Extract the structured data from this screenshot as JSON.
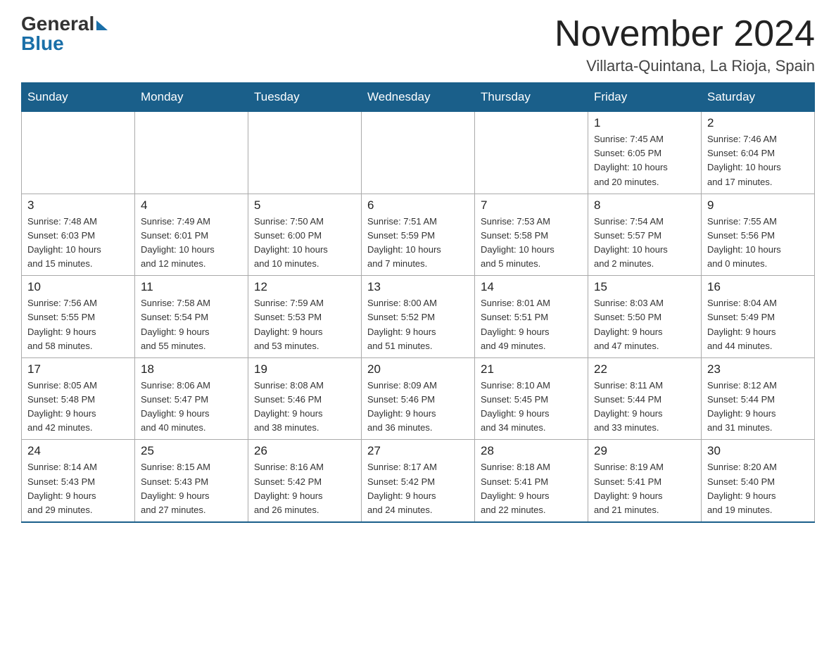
{
  "header": {
    "logo_general": "General",
    "logo_blue": "Blue",
    "month_year": "November 2024",
    "location": "Villarta-Quintana, La Rioja, Spain"
  },
  "days_of_week": [
    "Sunday",
    "Monday",
    "Tuesday",
    "Wednesday",
    "Thursday",
    "Friday",
    "Saturday"
  ],
  "weeks": [
    {
      "days": [
        {
          "number": "",
          "info": ""
        },
        {
          "number": "",
          "info": ""
        },
        {
          "number": "",
          "info": ""
        },
        {
          "number": "",
          "info": ""
        },
        {
          "number": "",
          "info": ""
        },
        {
          "number": "1",
          "info": "Sunrise: 7:45 AM\nSunset: 6:05 PM\nDaylight: 10 hours\nand 20 minutes."
        },
        {
          "number": "2",
          "info": "Sunrise: 7:46 AM\nSunset: 6:04 PM\nDaylight: 10 hours\nand 17 minutes."
        }
      ]
    },
    {
      "days": [
        {
          "number": "3",
          "info": "Sunrise: 7:48 AM\nSunset: 6:03 PM\nDaylight: 10 hours\nand 15 minutes."
        },
        {
          "number": "4",
          "info": "Sunrise: 7:49 AM\nSunset: 6:01 PM\nDaylight: 10 hours\nand 12 minutes."
        },
        {
          "number": "5",
          "info": "Sunrise: 7:50 AM\nSunset: 6:00 PM\nDaylight: 10 hours\nand 10 minutes."
        },
        {
          "number": "6",
          "info": "Sunrise: 7:51 AM\nSunset: 5:59 PM\nDaylight: 10 hours\nand 7 minutes."
        },
        {
          "number": "7",
          "info": "Sunrise: 7:53 AM\nSunset: 5:58 PM\nDaylight: 10 hours\nand 5 minutes."
        },
        {
          "number": "8",
          "info": "Sunrise: 7:54 AM\nSunset: 5:57 PM\nDaylight: 10 hours\nand 2 minutes."
        },
        {
          "number": "9",
          "info": "Sunrise: 7:55 AM\nSunset: 5:56 PM\nDaylight: 10 hours\nand 0 minutes."
        }
      ]
    },
    {
      "days": [
        {
          "number": "10",
          "info": "Sunrise: 7:56 AM\nSunset: 5:55 PM\nDaylight: 9 hours\nand 58 minutes."
        },
        {
          "number": "11",
          "info": "Sunrise: 7:58 AM\nSunset: 5:54 PM\nDaylight: 9 hours\nand 55 minutes."
        },
        {
          "number": "12",
          "info": "Sunrise: 7:59 AM\nSunset: 5:53 PM\nDaylight: 9 hours\nand 53 minutes."
        },
        {
          "number": "13",
          "info": "Sunrise: 8:00 AM\nSunset: 5:52 PM\nDaylight: 9 hours\nand 51 minutes."
        },
        {
          "number": "14",
          "info": "Sunrise: 8:01 AM\nSunset: 5:51 PM\nDaylight: 9 hours\nand 49 minutes."
        },
        {
          "number": "15",
          "info": "Sunrise: 8:03 AM\nSunset: 5:50 PM\nDaylight: 9 hours\nand 47 minutes."
        },
        {
          "number": "16",
          "info": "Sunrise: 8:04 AM\nSunset: 5:49 PM\nDaylight: 9 hours\nand 44 minutes."
        }
      ]
    },
    {
      "days": [
        {
          "number": "17",
          "info": "Sunrise: 8:05 AM\nSunset: 5:48 PM\nDaylight: 9 hours\nand 42 minutes."
        },
        {
          "number": "18",
          "info": "Sunrise: 8:06 AM\nSunset: 5:47 PM\nDaylight: 9 hours\nand 40 minutes."
        },
        {
          "number": "19",
          "info": "Sunrise: 8:08 AM\nSunset: 5:46 PM\nDaylight: 9 hours\nand 38 minutes."
        },
        {
          "number": "20",
          "info": "Sunrise: 8:09 AM\nSunset: 5:46 PM\nDaylight: 9 hours\nand 36 minutes."
        },
        {
          "number": "21",
          "info": "Sunrise: 8:10 AM\nSunset: 5:45 PM\nDaylight: 9 hours\nand 34 minutes."
        },
        {
          "number": "22",
          "info": "Sunrise: 8:11 AM\nSunset: 5:44 PM\nDaylight: 9 hours\nand 33 minutes."
        },
        {
          "number": "23",
          "info": "Sunrise: 8:12 AM\nSunset: 5:44 PM\nDaylight: 9 hours\nand 31 minutes."
        }
      ]
    },
    {
      "days": [
        {
          "number": "24",
          "info": "Sunrise: 8:14 AM\nSunset: 5:43 PM\nDaylight: 9 hours\nand 29 minutes."
        },
        {
          "number": "25",
          "info": "Sunrise: 8:15 AM\nSunset: 5:43 PM\nDaylight: 9 hours\nand 27 minutes."
        },
        {
          "number": "26",
          "info": "Sunrise: 8:16 AM\nSunset: 5:42 PM\nDaylight: 9 hours\nand 26 minutes."
        },
        {
          "number": "27",
          "info": "Sunrise: 8:17 AM\nSunset: 5:42 PM\nDaylight: 9 hours\nand 24 minutes."
        },
        {
          "number": "28",
          "info": "Sunrise: 8:18 AM\nSunset: 5:41 PM\nDaylight: 9 hours\nand 22 minutes."
        },
        {
          "number": "29",
          "info": "Sunrise: 8:19 AM\nSunset: 5:41 PM\nDaylight: 9 hours\nand 21 minutes."
        },
        {
          "number": "30",
          "info": "Sunrise: 8:20 AM\nSunset: 5:40 PM\nDaylight: 9 hours\nand 19 minutes."
        }
      ]
    }
  ]
}
